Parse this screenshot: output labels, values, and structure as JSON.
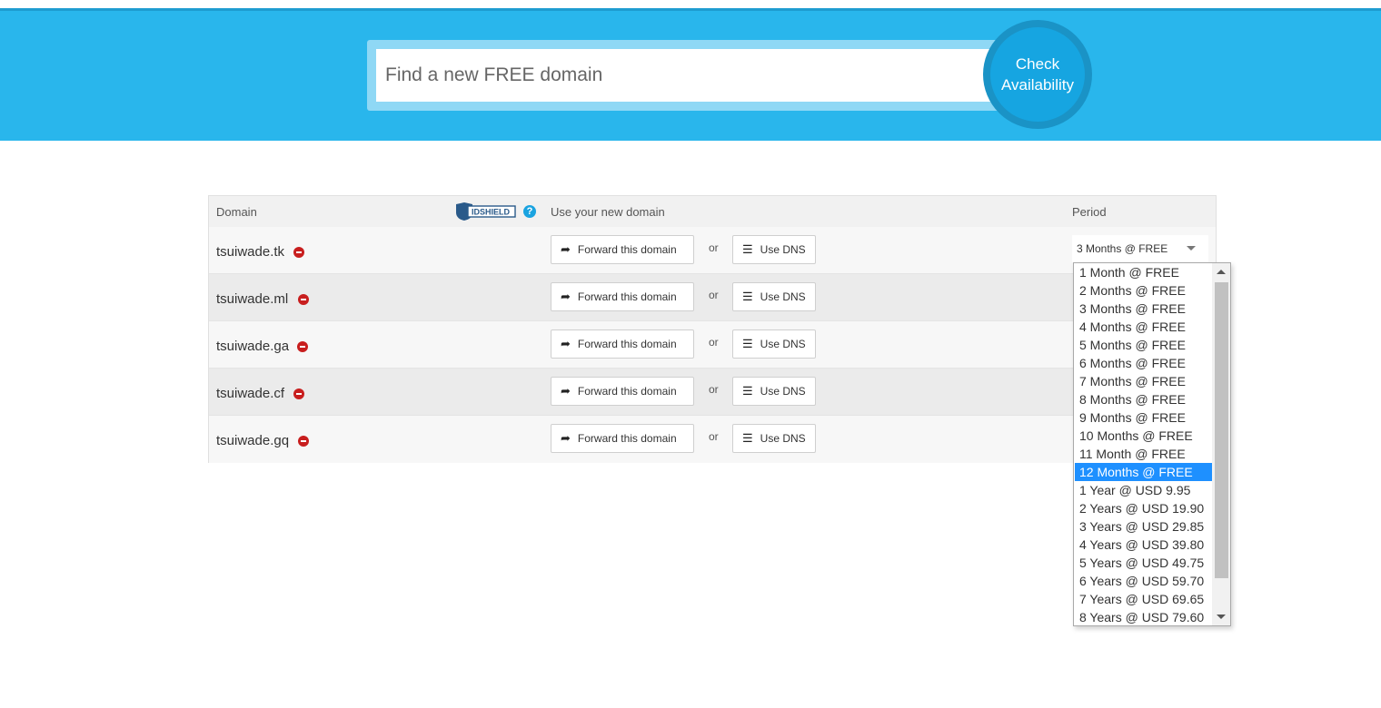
{
  "search": {
    "placeholder": "Find a new FREE domain",
    "button_line1": "Check",
    "button_line2": "Availability"
  },
  "table": {
    "headers": {
      "domain": "Domain",
      "use_domain": "Use your new domain",
      "period": "Period",
      "idshield_logo": "IDSHIELD"
    },
    "help_icon": "?",
    "or_label": "or",
    "forward_label": "Forward this domain",
    "dns_label": "Use DNS",
    "rows": [
      {
        "domain": "tsuiwade.tk",
        "period": "3 Months @ FREE"
      },
      {
        "domain": "tsuiwade.ml"
      },
      {
        "domain": "tsuiwade.ga"
      },
      {
        "domain": "tsuiwade.cf"
      },
      {
        "domain": "tsuiwade.gq"
      }
    ]
  },
  "period_dropdown": {
    "selected": "12 Months @ FREE",
    "options": [
      "1 Month @ FREE",
      "2 Months @ FREE",
      "3 Months @ FREE",
      "4 Months @ FREE",
      "5 Months @ FREE",
      "6 Months @ FREE",
      "7 Months @ FREE",
      "8 Months @ FREE",
      "9 Months @ FREE",
      "10 Months @ FREE",
      "11 Month @ FREE",
      "12 Months @ FREE",
      "1 Year @ USD 9.95",
      "2 Years @ USD 19.90",
      "3 Years @ USD 29.85",
      "4 Years @ USD 39.80",
      "5 Years @ USD 49.75",
      "6 Years @ USD 59.70",
      "7 Years @ USD 69.65",
      "8 Years @ USD 79.60"
    ]
  },
  "colors": {
    "hero_bg": "#29b6ec",
    "check_button": "#16a5e1",
    "remove_icon": "#c81e1e",
    "selected_option": "#1e90ff"
  },
  "icons": {
    "remove": "remove-circle-icon",
    "forward": "share-arrow-icon",
    "dns": "list-icon",
    "help": "question-circle-icon"
  }
}
